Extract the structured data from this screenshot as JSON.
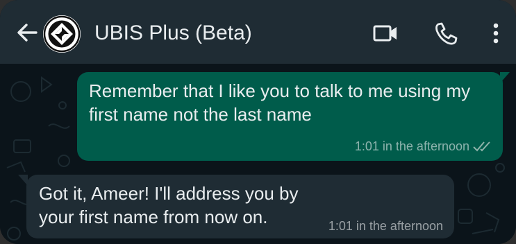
{
  "header": {
    "contact_name": "UBIS Plus (Beta)",
    "icons": [
      "back-arrow-icon",
      "contact-avatar",
      "video-call-icon",
      "phone-call-icon",
      "more-options-icon"
    ]
  },
  "messages": [
    {
      "direction": "outgoing",
      "text": "Remember that I like you to talk to me using my first name not the last name",
      "time": "1:01 in the afternoon",
      "status": "read-double-check"
    },
    {
      "direction": "incoming",
      "text": "Got it, Ameer! I'll address you by your first name from now on.",
      "time": "1:01 in the afternoon"
    }
  ],
  "colors": {
    "header_bg": "#1f2c34",
    "chat_bg": "#0b141a",
    "outgoing_bubble": "#005c4b",
    "incoming_bubble": "#1f2c34",
    "text": "#e9edef",
    "meta": "#8696a0"
  }
}
